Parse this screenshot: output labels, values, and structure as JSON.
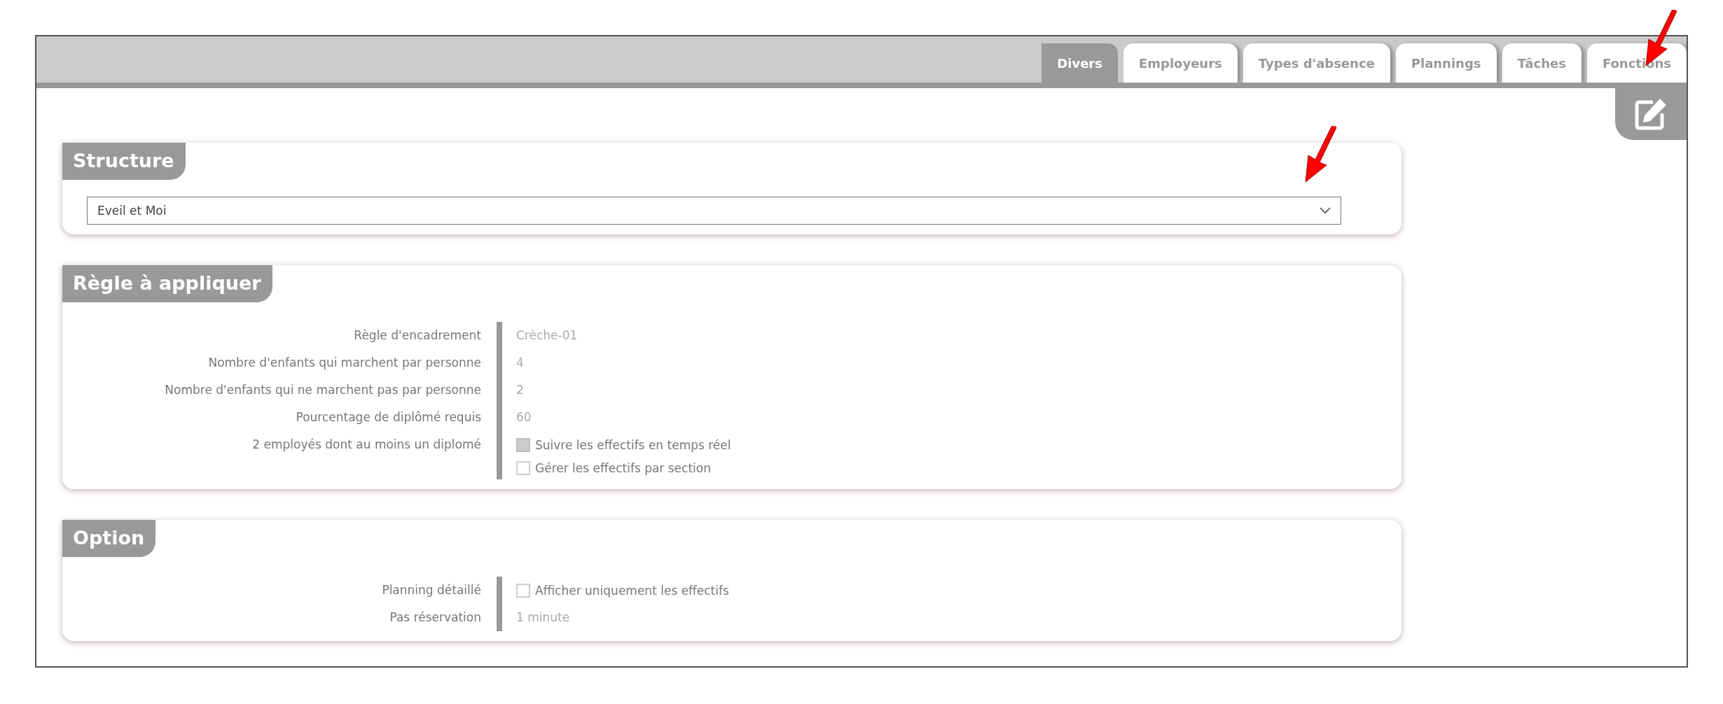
{
  "tabs": [
    {
      "label": "Divers",
      "selected": true
    },
    {
      "label": "Employeurs",
      "selected": false
    },
    {
      "label": "Types d'absence",
      "selected": false
    },
    {
      "label": "Plannings",
      "selected": false
    },
    {
      "label": "Tâches",
      "selected": false
    },
    {
      "label": "Fonctions",
      "selected": false
    }
  ],
  "panels": [
    {
      "title": "Structure",
      "kind": "select",
      "value": "Eveil et Moi"
    },
    {
      "title": "Règle à appliquer",
      "kind": "form",
      "rows": [
        {
          "label": "Règle d'encadrement",
          "kind": "value",
          "value": "Crèche-01"
        },
        {
          "label": "Nombre d'enfants qui marchent par personne",
          "kind": "value",
          "value": "4"
        },
        {
          "label": "Nombre d'enfants qui ne marchent pas par personne",
          "kind": "value",
          "value": "2"
        },
        {
          "label": "Pourcentage de diplômé requis",
          "kind": "value",
          "value": "60"
        },
        {
          "label": "2 employés dont au moins un diplomé",
          "kind": "checkboxes",
          "options": [
            {
              "label": "Suivre les effectifs en temps réel",
              "checked": true
            },
            {
              "label": "Gérer les effectifs par section",
              "checked": false
            }
          ]
        }
      ]
    },
    {
      "title": "Option",
      "kind": "form",
      "rows": [
        {
          "label": "Planning détaillé",
          "kind": "checkboxes",
          "options": [
            {
              "label": "Afficher uniquement les effectifs",
              "checked": false
            }
          ]
        },
        {
          "label": "Pas réservation",
          "kind": "value",
          "value": "1 minute"
        }
      ]
    }
  ]
}
